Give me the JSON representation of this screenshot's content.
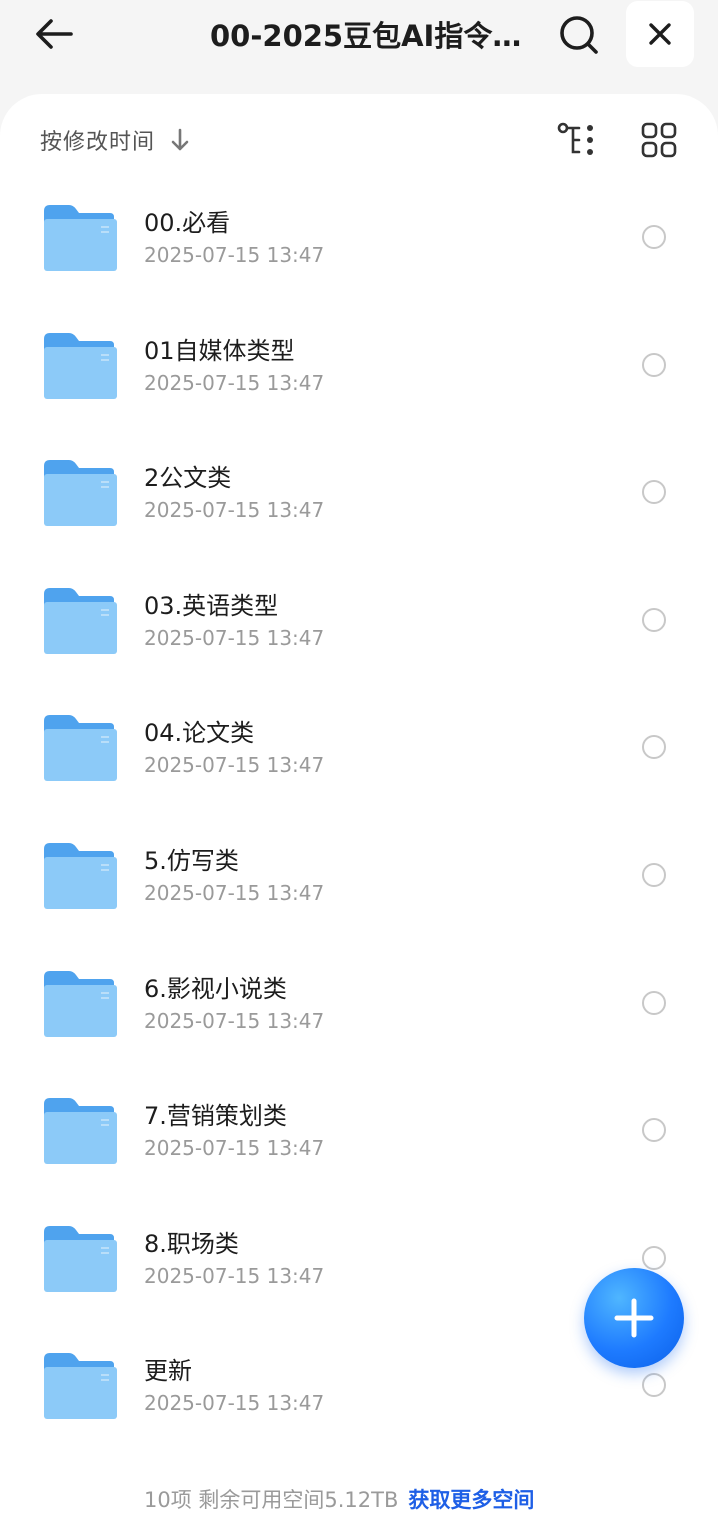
{
  "header": {
    "title": "00-2025豆包AI指令…",
    "back_icon": "arrow-left-icon",
    "search_icon": "search-icon",
    "close_icon": "close-icon"
  },
  "toolbar": {
    "sort_label": "按修改时间",
    "sort_icon": "arrow-down-icon",
    "tree_icon": "tree-view-icon",
    "grid_icon": "grid-view-icon"
  },
  "files": [
    {
      "name": "00.必看",
      "date": "2025-07-15 13:47",
      "type": "folder"
    },
    {
      "name": "01自媒体类型",
      "date": "2025-07-15 13:47",
      "type": "folder"
    },
    {
      "name": "2公文类",
      "date": "2025-07-15 13:47",
      "type": "folder"
    },
    {
      "name": "03.英语类型",
      "date": "2025-07-15 13:47",
      "type": "folder"
    },
    {
      "name": "04.论文类",
      "date": "2025-07-15 13:47",
      "type": "folder"
    },
    {
      "name": "5.仿写类",
      "date": "2025-07-15 13:47",
      "type": "folder"
    },
    {
      "name": "6.影视小说类",
      "date": "2025-07-15 13:47",
      "type": "folder"
    },
    {
      "name": "7.营销策划类",
      "date": "2025-07-15 13:47",
      "type": "folder"
    },
    {
      "name": "8.职场类",
      "date": "2025-07-15 13:47",
      "type": "folder"
    },
    {
      "name": "更新",
      "date": "2025-07-15 13:47",
      "type": "folder"
    }
  ],
  "fab": {
    "icon": "plus-icon"
  },
  "footer": {
    "summary": "10项 剩余可用空间5.12TB",
    "link_label": "获取更多空间"
  },
  "colors": {
    "accent": "#1e7bff",
    "folder": "#6fb6f5",
    "link": "#1e5fe6"
  }
}
